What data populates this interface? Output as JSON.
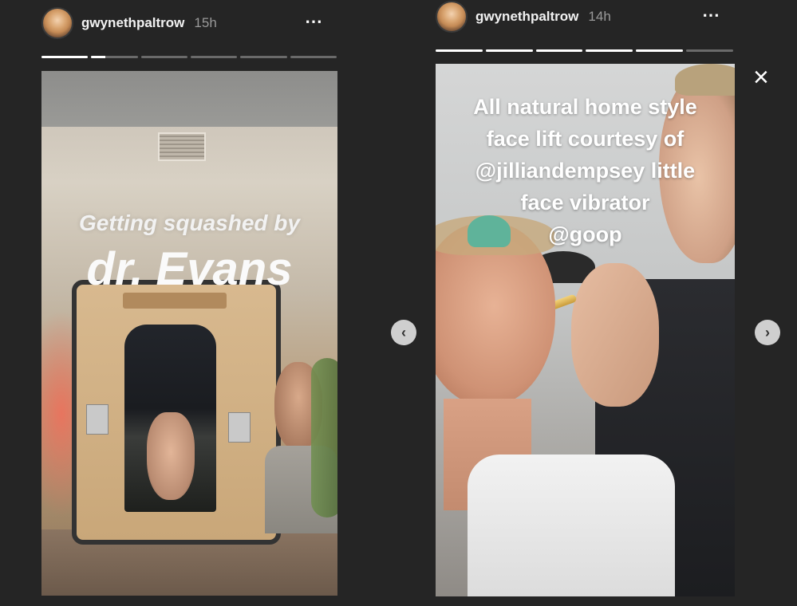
{
  "left_story": {
    "username": "gwynethpaltrow",
    "time": "15h",
    "more_icon": "⋯",
    "progress": [
      1,
      0.3,
      0,
      0,
      0,
      0
    ],
    "caption_line1": "Getting squashed by",
    "caption_line2": "dr. Evans"
  },
  "right_story": {
    "username": "gwynethpaltrow",
    "time": "14h",
    "more_icon": "⋯",
    "progress": [
      1,
      1,
      1,
      1,
      1,
      0
    ],
    "caption_lines": [
      "All natural home style",
      "face lift courtesy of",
      "@jilliandempsey little",
      "face vibrator",
      "@goop"
    ]
  },
  "controls": {
    "prev_icon": "‹",
    "next_icon": "›",
    "close_icon": "×"
  }
}
